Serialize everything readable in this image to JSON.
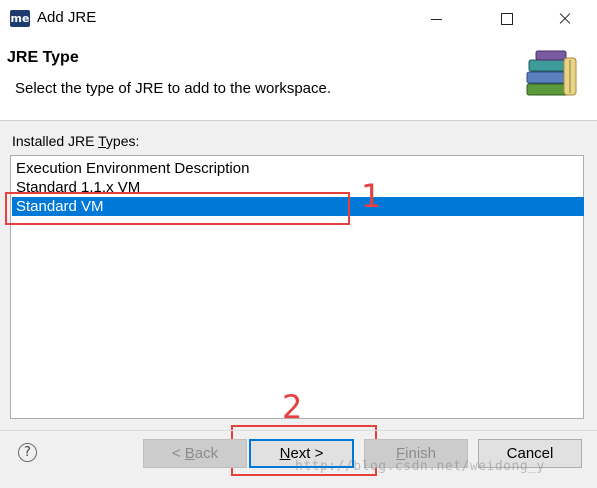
{
  "window": {
    "app_icon_text": "me",
    "title": "Add JRE"
  },
  "header": {
    "title": "JRE Type",
    "description": "Select the type of JRE to add to the workspace."
  },
  "list": {
    "label_prefix": "Installed JRE ",
    "label_mnemonic": "T",
    "label_suffix": "ypes:",
    "items": [
      {
        "label": "Execution Environment Description",
        "selected": false
      },
      {
        "label": "Standard 1.1.x VM",
        "selected": false
      },
      {
        "label": "Standard VM",
        "selected": true
      }
    ]
  },
  "annotations": {
    "step1": "1",
    "step2": "2",
    "color": "#e64040"
  },
  "buttons": {
    "back": {
      "prefix": "< ",
      "mnemonic": "B",
      "suffix": "ack",
      "enabled": false
    },
    "next": {
      "mnemonic": "N",
      "suffix": "ext >",
      "enabled": true
    },
    "finish": {
      "mnemonic": "F",
      "suffix": "inish",
      "enabled": false
    },
    "cancel": {
      "label": "Cancel",
      "enabled": true
    }
  },
  "help_icon_glyph": "?",
  "watermark": "http://blog.csdn.net/weidong_y",
  "colors": {
    "selection": "#0078d7",
    "annotation": "#e64040"
  }
}
